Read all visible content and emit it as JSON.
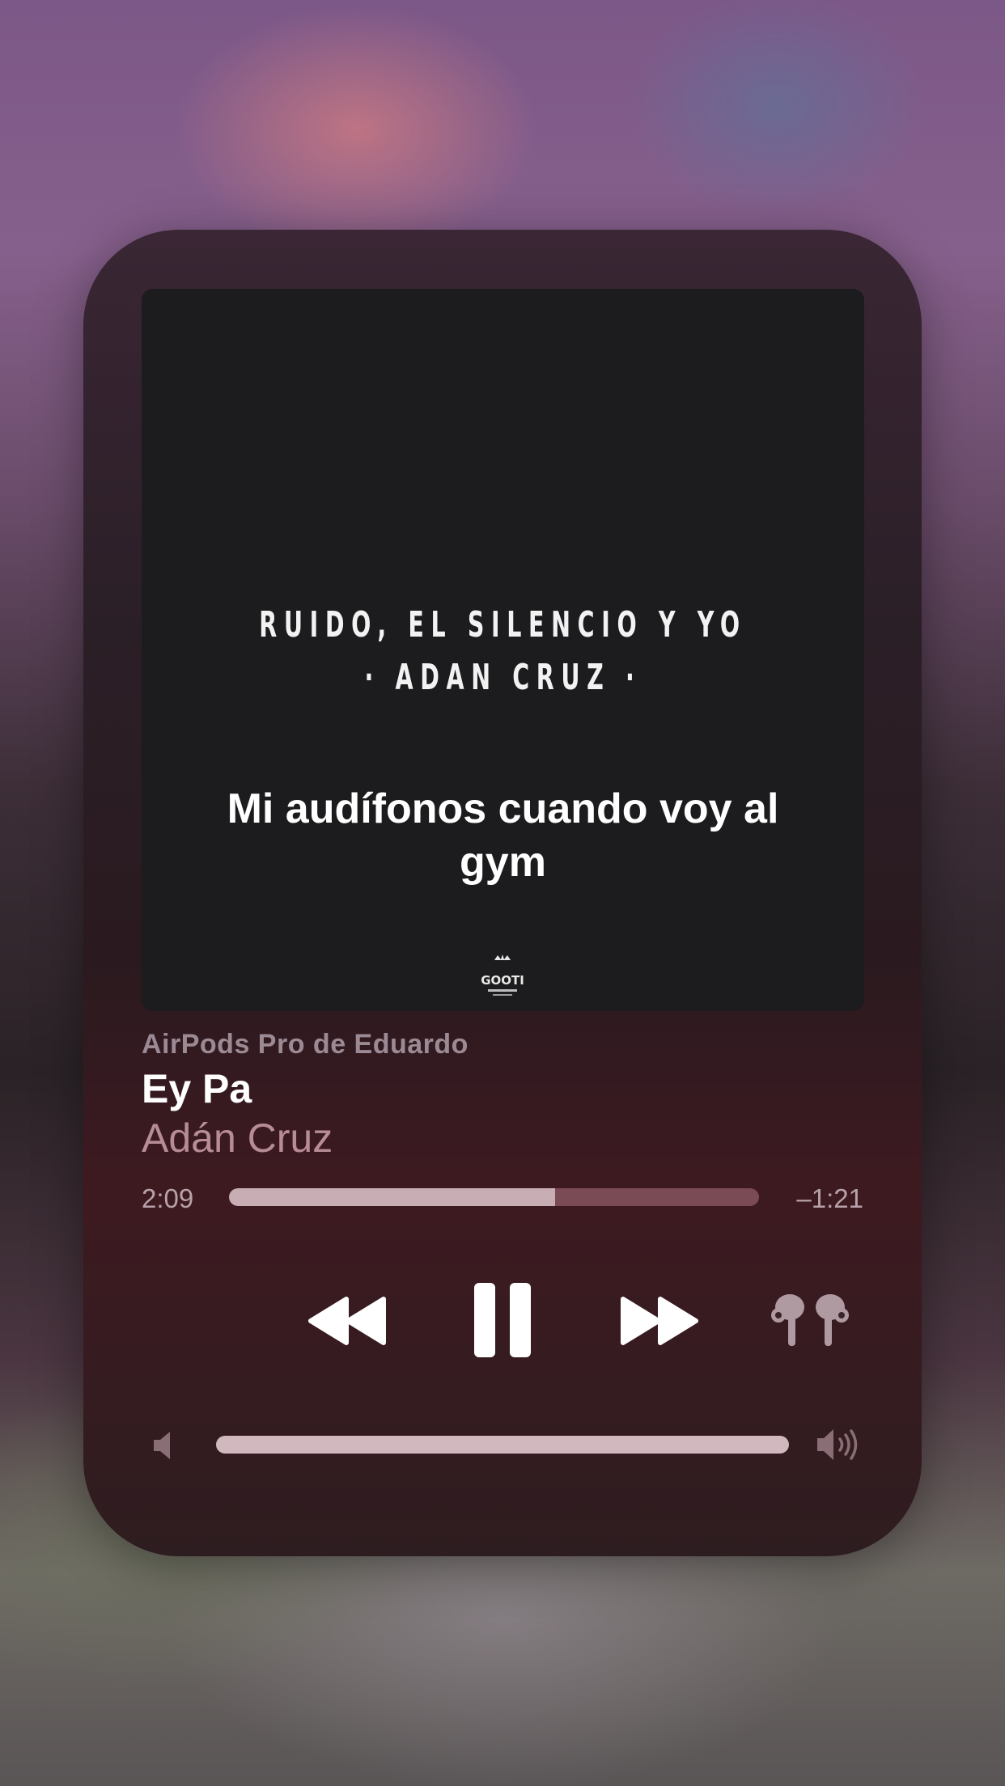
{
  "artwork": {
    "title_line1": "RUIDO, EL SILENCIO Y YO",
    "title_line2": "· ADAN CRUZ ·",
    "caption": "Mi audífonos cuando voy al gym",
    "logo_text": "GOOTI"
  },
  "now_playing": {
    "device": "AirPods Pro de Eduardo",
    "title": "Ey Pa",
    "artist": "Adán Cruz",
    "elapsed": "2:09",
    "remaining": "–1:21",
    "progress_fraction": 0.615
  },
  "controls": {
    "rewind_icon": "rewind-icon",
    "pause_icon": "pause-icon",
    "forward_icon": "fast-forward-icon",
    "output_icon": "airpods-pro-icon"
  },
  "volume": {
    "level_fraction": 1.0,
    "low_icon": "speaker-low-icon",
    "high_icon": "speaker-high-icon"
  },
  "colors": {
    "accent_text": "#b78c97",
    "progress_fill": "#c8aeb4",
    "progress_track": "#7a4a55"
  }
}
